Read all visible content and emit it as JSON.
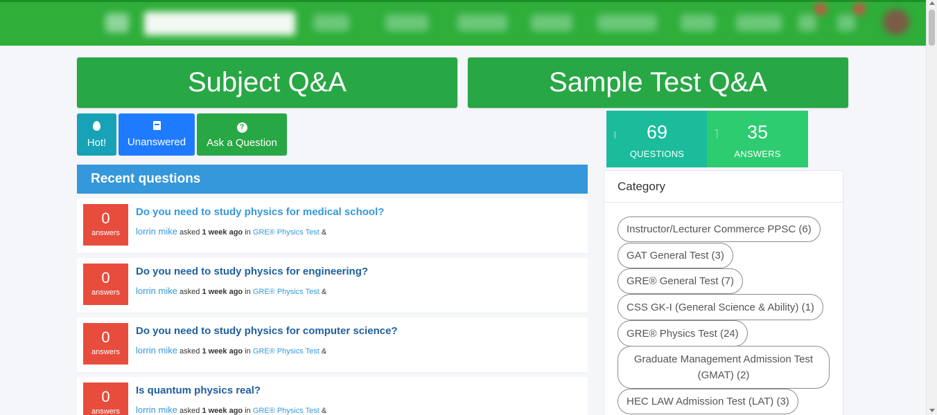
{
  "nav": {
    "big_buttons": {
      "subject": "Subject Q&A",
      "sample": "Sample Test Q&A"
    },
    "pills": {
      "hot": "Hot!",
      "unanswered": "Unanswered",
      "ask": "Ask a Question"
    }
  },
  "recent": {
    "header": "Recent questions",
    "questions": [
      {
        "count": "0",
        "count_label": "answers",
        "title": "Do you need to study physics for medical school?",
        "user": "lorrin mike",
        "asked": "asked",
        "when": "1 week ago",
        "in": "in",
        "category": "GRE® Physics Test",
        "suffix": "&"
      },
      {
        "count": "0",
        "count_label": "answers",
        "title": "Do you need to study physics for engineering?",
        "user": "lorrin mike",
        "asked": "asked",
        "when": "1 week ago",
        "in": "in",
        "category": "GRE® Physics Test",
        "suffix": "&"
      },
      {
        "count": "0",
        "count_label": "answers",
        "title": "Do you need to study physics for computer science?",
        "user": "lorrin mike",
        "asked": "asked",
        "when": "1 week ago",
        "in": "in",
        "category": "GRE® Physics Test",
        "suffix": "&"
      },
      {
        "count": "0",
        "count_label": "answers",
        "title": "Is quantum physics real?",
        "user": "lorrin mike",
        "asked": "asked",
        "when": "1 week ago",
        "in": "in",
        "category": "GRE® Physics Test",
        "suffix": "&"
      }
    ]
  },
  "stats": {
    "questions": {
      "value": "69",
      "label": "QUESTIONS"
    },
    "answers": {
      "value": "35",
      "label": "ANSWERS"
    }
  },
  "category": {
    "title": "Category",
    "tags": [
      "Instructor/Lecturer Commerce PPSC (6)",
      "GAT General Test (3)",
      "GRE® General Test (7)",
      "CSS GK-I (General Science & Ability) (1)",
      "GRE® Physics Test (24)",
      "Graduate Management Admission Test (GMAT) (2)",
      "HEC LAW Admission Test (LAT) (3)"
    ]
  },
  "colors": {
    "brand_green": "#28a745",
    "blue": "#3498db",
    "red": "#e74c3c",
    "teal": "#1abc9c",
    "emerald": "#2ecc71"
  },
  "icons": {
    "hot": "fire-icon",
    "unanswered": "book-icon",
    "ask": "question-circle-icon"
  }
}
